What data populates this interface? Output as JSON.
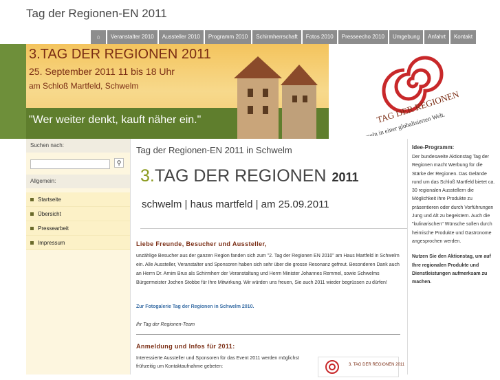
{
  "site_title": "Tag der Regionen-EN 2011",
  "nav": {
    "home_icon": "home-icon",
    "items": [
      "Veranstalter 2010",
      "Aussteller 2010",
      "Programm 2010",
      "Schirmherrschaft",
      "Fotos 2010",
      "Presseecho 2010",
      "Umgebung",
      "Anfahrt",
      "Kontakt"
    ]
  },
  "banner": {
    "title_a": "3.TAG DER REGION",
    "title_b": "EN 2011",
    "date": "25. September 2011  11 bis 18 Uhr",
    "place": "am Schloß Martfeld, Schwelm",
    "slogan": "\"Wer weiter denkt, kauft näher ein.\"",
    "logo_text": "TAG DER REGIONEN",
    "logo_tagline": "... wurzeln in einer globalisierten Welt."
  },
  "sidebar": {
    "search_heading": "Suchen nach:",
    "search_value": "",
    "general_heading": "Allgemein:",
    "items": [
      "Startseite",
      "Übersicht",
      "Pressearbeit",
      "Impressum"
    ]
  },
  "main": {
    "heading": "Tag der Regionen-EN 2011 in Schwelm",
    "logo": {
      "num": "3.",
      "title": "TAG DER REGION",
      "en": "EN",
      "year": "2011",
      "subtitle": "schwelm | haus martfeld | am 25.09.2011"
    },
    "intro": "Liebe Freunde, Besucher und Aussteller,",
    "body": "unzählige Besucher aus der ganzen Region fanden sich zum \"2. Tag der Regionen EN 2010\" am Haus Martfeld in Schwelm ein. Alle Aussteller, Veranstalter und Sponsoren haben sich sehr über die grosse Resonanz gefreut. Besonderen Dank auch an Herrn Dr. Arnim Brux als Schirmherr der Veranstaltung und Herrn Minister Johannes Remmel, sowie Schwelms Bürgermeister Jochen Stobbe für Ihre Mitwirkung. Wir würden uns freuen, Sie auch 2011 wieder begrüssen zu dürfen!",
    "gallery_link": "Zur Fotogalerie Tag der Regionen in Schwelm 2010.",
    "signature": "Ihr Tag der Regionen-Team",
    "section2_heading": "Anmeldung und Infos für 2011:",
    "section2_body": "Interessierte Aussteller und Sponsoren für das Event 2011 werden möglichst frühzeitig um Kontaktaufnahme gebeten:",
    "thumb_text": "3. TAG DER REGIONEN 2011"
  },
  "right": {
    "heading": "Idee-Programm:",
    "text": "Der bundesweite Aktionstag Tag der Regionen macht Werbung für die Stärke der Regionen. Das Gelände rund um das Schloß Martfeld bietet ca. 30 regionalen Ausstellern die Möglichkeit ihre Produkte zu präsentieren oder durch Vorführungen Jung und Alt zu begeistern. Auch die \"kulinarischen\" Wünsche sollen durch heimische Produkte und Gastronome angesprochen werden.",
    "bold_text": "Nutzen Sie den Aktionstag, um auf Ihre regionalen Produkte und Dienstleistungen aufmerksam zu machen."
  },
  "colors": {
    "nav_bg": "#8d8d8d",
    "banner_yellow": "#f5c96b",
    "banner_green": "#5f7e2d",
    "accent_brown": "#7a2d14",
    "link_blue": "#3a6ea5",
    "sidebar_bg": "#fcf1c7"
  }
}
